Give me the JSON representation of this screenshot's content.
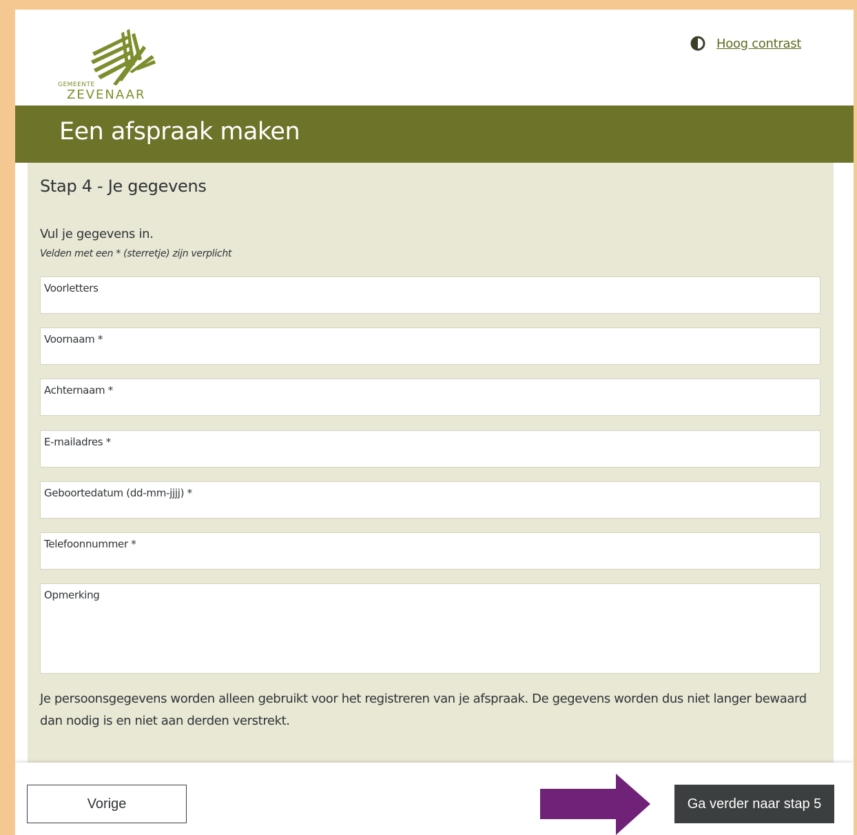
{
  "header": {
    "logo": {
      "line1": "GEMEENTE",
      "line2": "ZEVENAAR",
      "color": "#7c8e2d"
    },
    "contrast_toggle": {
      "icon": "half-circle-contrast-icon",
      "label": "Hoog contrast"
    }
  },
  "banner": {
    "title": "Een afspraak maken",
    "color": "#6e732a"
  },
  "form": {
    "step_title": "Stap 4 - Je gegevens",
    "intro": "Vul je gegevens in.",
    "required_note": "Velden met een * (sterretje) zijn verplicht",
    "fields": [
      {
        "label": "Voorletters",
        "value": ""
      },
      {
        "label": "Voornaam *",
        "value": ""
      },
      {
        "label": "Achternaam *",
        "value": ""
      },
      {
        "label": "E-mailadres *",
        "value": ""
      },
      {
        "label": "Geboortedatum (dd-mm-jjjj) *",
        "value": ""
      },
      {
        "label": "Telefoonnummer *",
        "value": ""
      },
      {
        "label": "Opmerking",
        "value": ""
      }
    ],
    "privacy_text": "Je persoonsgegevens worden alleen gebruikt voor het registreren van je afspraak. De gegevens worden dus niet langer bewaard dan nodig is en niet aan derden verstrekt."
  },
  "footer": {
    "prev_label": "Vorige",
    "next_label": "Ga verder naar stap 5",
    "arrow_icon": "right-arrow-icon",
    "arrow_color": "#6f2277"
  },
  "colors": {
    "page_border": "#f5c892",
    "panel_bg": "#e8e8d4",
    "next_button_bg": "#3b3f3f"
  }
}
